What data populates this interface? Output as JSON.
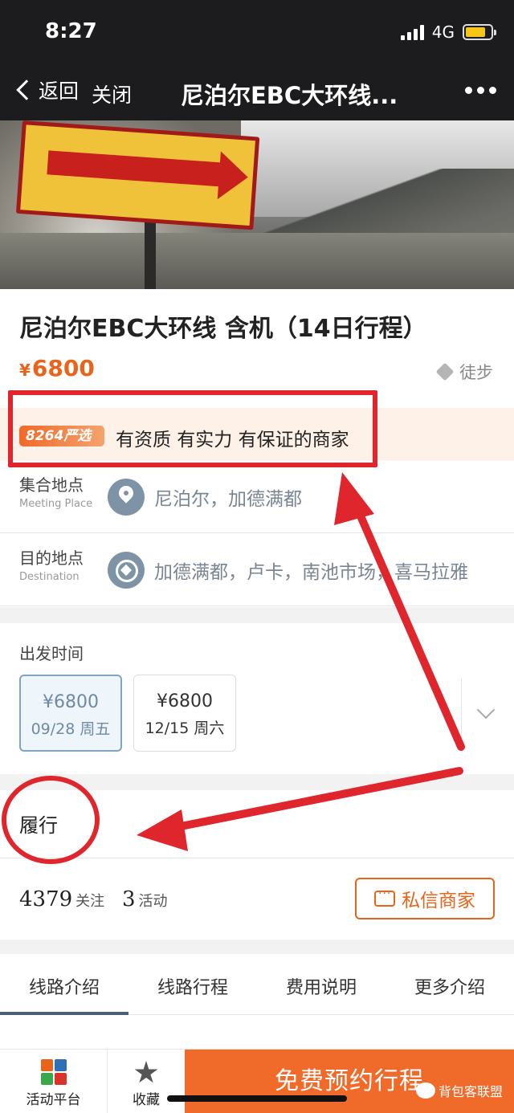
{
  "status": {
    "time": "8:27",
    "network": "4G"
  },
  "nav": {
    "back_label": "返回",
    "close_label": "关闭",
    "title": "尼泊尔EBC大环线..."
  },
  "product": {
    "title": "尼泊尔EBC大环线 含机（14日行程）",
    "price_currency": "¥",
    "price_value": "6800",
    "activity_type": "徒步",
    "promo_badge": "8264严选",
    "promo_text": "有资质 有实力 有保证的商家"
  },
  "meeting": {
    "label": "集合地点",
    "sublabel": "Meeting Place",
    "value": "尼泊尔，加德满都"
  },
  "destination": {
    "label": "目的地点",
    "sublabel": "Destination",
    "value": "加德满都，卢卡，南池市场，喜马拉雅"
  },
  "departure": {
    "label": "出发时间",
    "dates": [
      {
        "price": "¥6800",
        "date": "09/28 周五",
        "selected": true
      },
      {
        "price": "¥6800",
        "date": "12/15 周六",
        "selected": false
      }
    ]
  },
  "fulfillment": {
    "label": "履行"
  },
  "stats": {
    "followers": "4379",
    "followers_unit": "关注",
    "activities": "3",
    "activities_unit": "活动",
    "message_button": "私信商家"
  },
  "tabs": [
    "线路介绍",
    "线路行程",
    "费用说明",
    "更多介绍"
  ],
  "bottom": {
    "platform_label": "活动平台",
    "favorite_label": "收藏",
    "book_label": "免费预约行程",
    "watermark": "背包客联盟"
  },
  "colors": {
    "accent": "#f06a2a",
    "price": "#e8641b",
    "annotation": "#e0262d",
    "nav_bg": "#1c1c1e"
  }
}
